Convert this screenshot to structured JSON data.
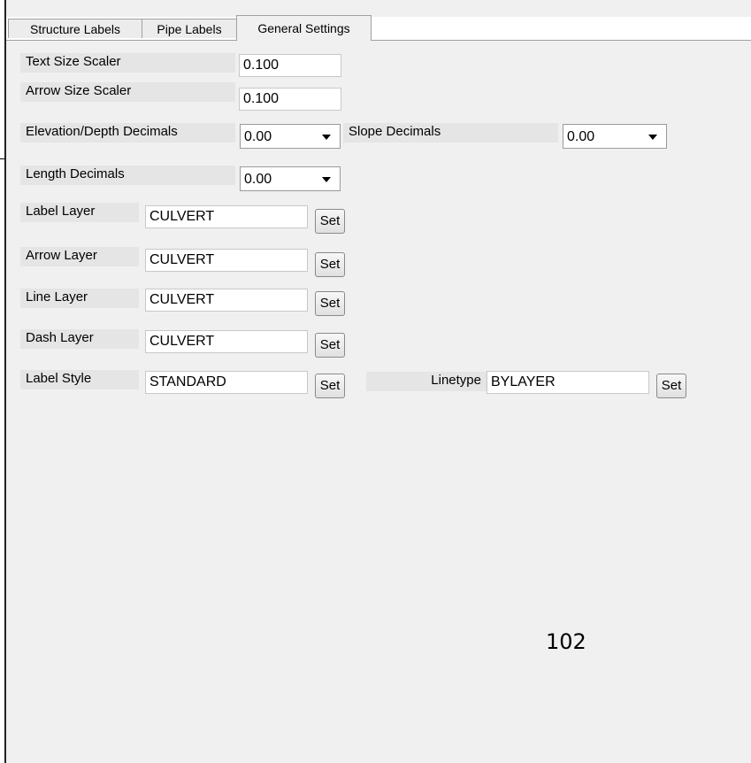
{
  "tabs": {
    "structure_labels": "Structure Labels",
    "pipe_labels": "Pipe Labels",
    "general_settings": "General Settings"
  },
  "fields": {
    "text_size_scaler": {
      "label": "Text Size Scaler",
      "value": "0.100"
    },
    "arrow_size_scaler": {
      "label": "Arrow Size Scaler",
      "value": "0.100"
    },
    "elevation_depth_decimals": {
      "label": "Elevation/Depth Decimals",
      "value": "0.00"
    },
    "slope_decimals": {
      "label": "Slope Decimals",
      "value": "0.00"
    },
    "length_decimals": {
      "label": "Length Decimals",
      "value": "0.00"
    },
    "label_layer": {
      "label": "Label Layer",
      "value": "CULVERT",
      "button": "Set"
    },
    "arrow_layer": {
      "label": "Arrow Layer",
      "value": "CULVERT",
      "button": "Set"
    },
    "line_layer": {
      "label": "Line Layer",
      "value": "CULVERT",
      "button": "Set"
    },
    "dash_layer": {
      "label": "Dash Layer",
      "value": "CULVERT",
      "button": "Set"
    },
    "label_style": {
      "label": "Label Style",
      "value": "STANDARD",
      "button": "Set"
    },
    "linetype": {
      "label": "Linetype",
      "value": "BYLAYER",
      "button": "Set"
    }
  },
  "page_number": "102"
}
